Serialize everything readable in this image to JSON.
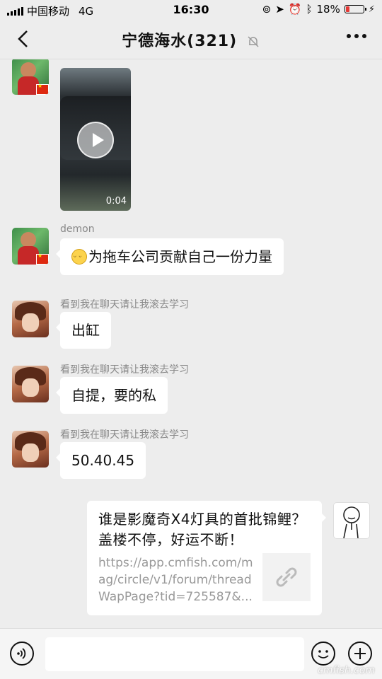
{
  "status_bar": {
    "carrier": "中国移动",
    "network": "4G",
    "time": "16:30",
    "battery": "18%",
    "battery_level": 0.18
  },
  "header": {
    "title": "宁德海水(321)",
    "back_icon": "chevron-left-icon",
    "mute_icon": "bell-off-icon",
    "more_icon": "more-dots-icon"
  },
  "messages": [
    {
      "sender": "demon",
      "type": "video",
      "duration": "0:04"
    },
    {
      "sender": "demon",
      "type": "text",
      "text": "为拖车公司贡献自己一份力量",
      "emoji": "smile-emoji"
    },
    {
      "sender": "看到我在聊天请让我滚去学习",
      "type": "text",
      "text": "出缸"
    },
    {
      "sender": "看到我在聊天请让我滚去学习",
      "type": "text",
      "text": "自提，要的私"
    },
    {
      "sender": "看到我在聊天请让我滚去学习",
      "type": "text",
      "text": "50.40.45"
    },
    {
      "sender": "me",
      "type": "link",
      "title": "谁是影魔奇X4灯具的首批锦鲤？盖楼不停，好运不断！",
      "desc": "https://app.cmfish.com/mag/circle/v1/forum/threadWapPage?tid=725587&...",
      "thumb_icon": "link-icon"
    }
  ],
  "input_bar": {
    "voice_icon": "voice-icon",
    "emoji_icon": "emoji-icon",
    "plus_icon": "plus-icon",
    "input_value": ""
  },
  "watermark": "cmfish.com",
  "colors": {
    "background": "#ededed",
    "bubble": "#ffffff",
    "battery_low": "#e53935"
  }
}
